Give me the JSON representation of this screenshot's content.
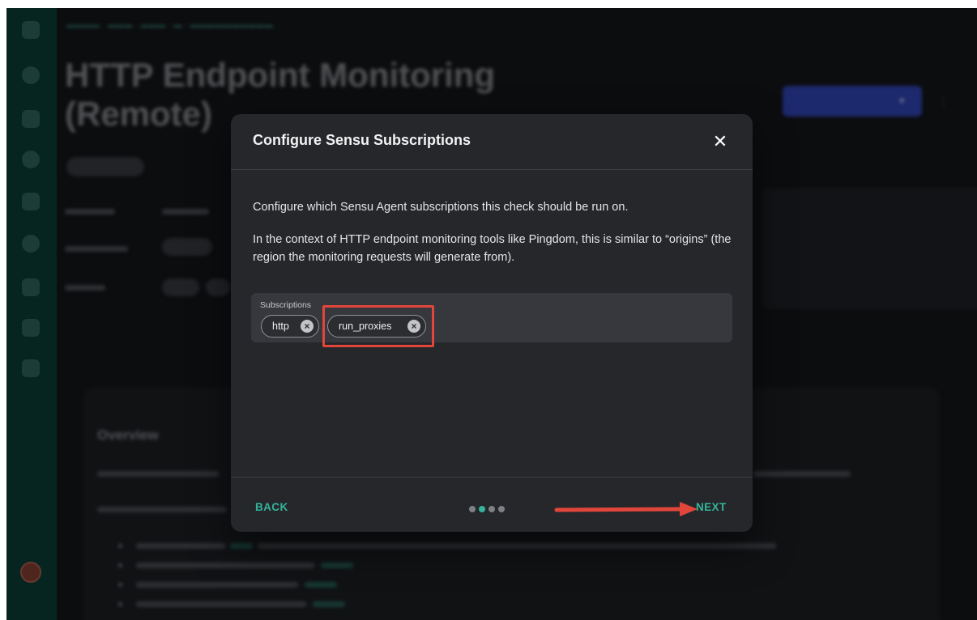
{
  "background": {
    "title_line1": "HTTP Endpoint Monitoring",
    "title_line2": "(Remote)",
    "overview_heading": "Overview"
  },
  "dialog": {
    "title": "Configure Sensu Subscriptions",
    "close_glyph": "✕",
    "paragraph1": "Configure which Sensu Agent subscriptions this check should be run on.",
    "paragraph2": "In the context of HTTP endpoint monitoring tools like Pingdom, this is similar to “origins” (the region the monitoring requests will generate from).",
    "subscriptions": {
      "label": "Subscriptions",
      "chips": [
        "http",
        "run_proxies"
      ],
      "remove_glyph": "×"
    },
    "footer": {
      "back_label": "BACK",
      "next_label": "NEXT",
      "steps_total": 4,
      "active_step": 2
    }
  },
  "colors": {
    "accent": "#34b49b",
    "annotation_red": "#e2463b",
    "sidebar": "#0c3a32",
    "dialog_bg": "#25272b"
  }
}
